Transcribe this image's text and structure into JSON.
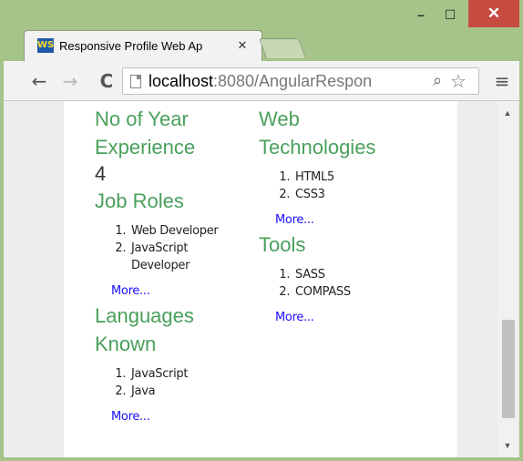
{
  "window": {
    "minimize_label": "–",
    "maximize_label": "☐",
    "close_label": "✕"
  },
  "tabs": [
    {
      "title": "Responsive Profile Web Ap",
      "close_label": "✕",
      "favicon": "WS"
    }
  ],
  "toolbar": {
    "back_icon": "←",
    "forward_icon": "→",
    "reload_icon": "C",
    "menu_icon": "≡",
    "url_host": "localhost",
    "url_path": ":8080/AngularRespon",
    "search_icon": "⌕",
    "star_icon": "☆"
  },
  "profile": {
    "experience_heading": "No of Year Experience",
    "experience_value": "4",
    "job_roles_heading": "Job Roles",
    "job_roles": [
      "Web Developer",
      "JavaScript Developer"
    ],
    "job_roles_more": "More...",
    "languages_heading": "Languages Known",
    "languages": [
      "JavaScript",
      "Java"
    ],
    "languages_more": "More...",
    "web_tech_heading": "Web Technologies",
    "web_tech": [
      "HTML5",
      "CSS3"
    ],
    "web_tech_more": "More...",
    "tools_heading": "Tools",
    "tools": [
      "SASS",
      "COMPASS"
    ],
    "tools_more": "More..."
  },
  "scrollbar": {
    "up_icon": "▲",
    "down_icon": "▼"
  },
  "colors": {
    "heading_green": "#4aa05c",
    "link_blue": "#1a0dff",
    "frame_green": "#a6c489",
    "close_red": "#c74b3f"
  }
}
